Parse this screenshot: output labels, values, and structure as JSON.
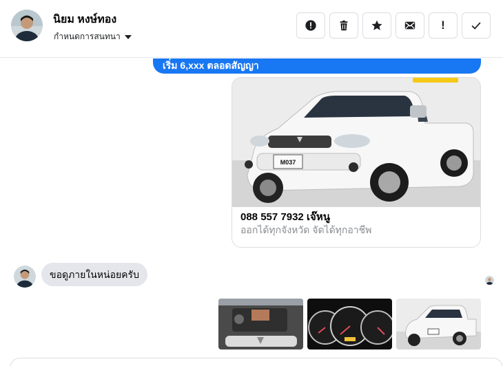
{
  "header": {
    "contact_name": "นิยม หงษ์ทอง",
    "conversation_settings": "กำหนดการสนทนา",
    "actions": [
      {
        "name": "report-icon",
        "label": "!"
      },
      {
        "name": "delete-icon"
      },
      {
        "name": "star-icon"
      },
      {
        "name": "mail-icon"
      },
      {
        "name": "mark-important-icon",
        "label": "!"
      },
      {
        "name": "check-icon"
      }
    ]
  },
  "messages": {
    "outgoing_partial_text": "เริ่ม 6,xxx ตลอดสัญญา",
    "card": {
      "plate_text": "M037",
      "title": "088 557 7932 เจ๊หนู",
      "subtitle": "ออกได้ทุกจังหวัด จัดได้ทุกอาชีพ"
    },
    "incoming_text": "ขอดูภายในหน่อยครับ"
  },
  "colors": {
    "accent": "#1877f2",
    "incoming_bubble": "#e4e6eb",
    "muted_text": "#8a8d91",
    "border": "#dadde1"
  }
}
